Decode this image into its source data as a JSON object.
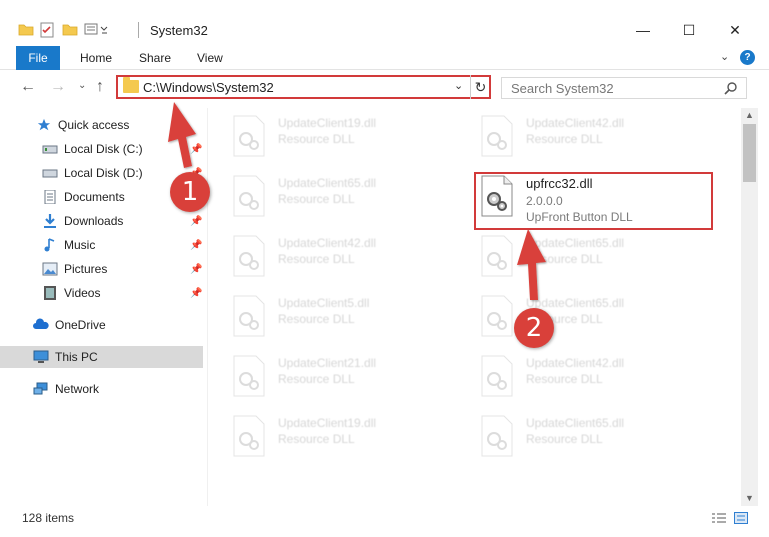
{
  "window": {
    "title": "System32",
    "minimize": "—",
    "maximize": "☐",
    "close": "✕"
  },
  "ribbon": {
    "tabs": [
      "File",
      "Home",
      "Share",
      "View"
    ],
    "help": "?"
  },
  "address": {
    "path": "C:\\Windows\\System32",
    "search_placeholder": "Search System32"
  },
  "sidebar": {
    "items": [
      {
        "label": "Quick access",
        "icon": "star-icon",
        "pinned": false
      },
      {
        "label": "Local Disk (C:)",
        "icon": "drive-icon",
        "pinned": true
      },
      {
        "label": "Local Disk (D:)",
        "icon": "drive-icon",
        "pinned": true
      },
      {
        "label": "Documents",
        "icon": "documents-icon",
        "pinned": true
      },
      {
        "label": "Downloads",
        "icon": "downloads-icon",
        "pinned": true
      },
      {
        "label": "Music",
        "icon": "music-icon",
        "pinned": true
      },
      {
        "label": "Pictures",
        "icon": "pictures-icon",
        "pinned": true
      },
      {
        "label": "Videos",
        "icon": "videos-icon",
        "pinned": true
      },
      {
        "label": "OneDrive",
        "icon": "cloud-icon",
        "pinned": false
      },
      {
        "label": "This PC",
        "icon": "computer-icon",
        "pinned": false,
        "selected": true
      },
      {
        "label": "Network",
        "icon": "network-icon",
        "pinned": false
      }
    ]
  },
  "files": {
    "highlighted": {
      "name": "upfrcc32.dll",
      "version": "2.0.0.0",
      "description": "UpFront Button DLL"
    },
    "faded": [
      {
        "name": "UpdateClient19.dll",
        "desc": "Resource DLL"
      },
      {
        "name": "UpdateClient42.dll",
        "desc": "Resource DLL"
      },
      {
        "name": "UpdateClient65.dll",
        "desc": "Resource DLL"
      },
      {
        "name": "UpdateClient42.dll",
        "desc": "Resource DLL"
      },
      {
        "name": "UpdateClient65.dll",
        "desc": "Resource DLL"
      },
      {
        "name": "UpdateClient5.dll",
        "desc": "Resource DLL"
      },
      {
        "name": "UpdateClient65.dll",
        "desc": "Resource DLL"
      },
      {
        "name": "UpdateClient21.dll",
        "desc": "Resource DLL"
      },
      {
        "name": "UpdateClient42.dll",
        "desc": "Resource DLL"
      },
      {
        "name": "UpdateClient19.dll",
        "desc": "Resource DLL"
      },
      {
        "name": "UpdateClient65.dll",
        "desc": "Resource DLL"
      }
    ]
  },
  "status": {
    "item_count": "128 items"
  },
  "annotations": {
    "step1": "1",
    "step2": "2",
    "color": "#d9403a"
  }
}
